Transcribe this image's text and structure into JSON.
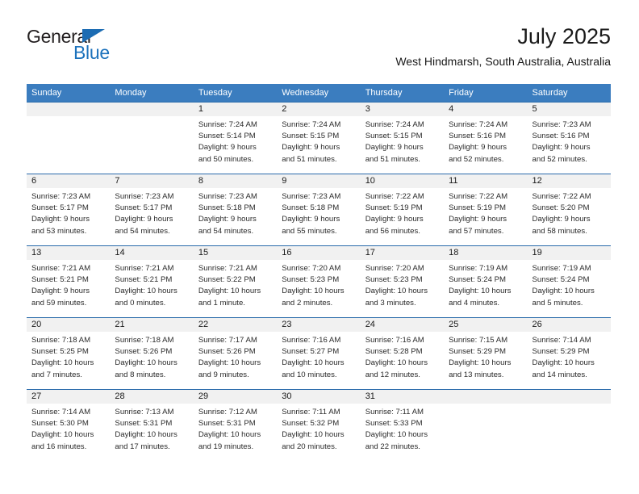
{
  "brand": {
    "name_part1": "General",
    "name_part2": "Blue"
  },
  "header": {
    "title": "July 2025",
    "subtitle": "West Hindmarsh, South Australia, Australia"
  },
  "colors": {
    "header_blue": "#3b7dbf",
    "row_rule_blue": "#2a6bab",
    "daynum_band": "#f1f1f1",
    "brand_blue": "#1c72bc",
    "text": "#1a1a1a"
  },
  "weekdays": [
    "Sunday",
    "Monday",
    "Tuesday",
    "Wednesday",
    "Thursday",
    "Friday",
    "Saturday"
  ],
  "weeks": [
    [
      {
        "day": "",
        "lines": []
      },
      {
        "day": "",
        "lines": []
      },
      {
        "day": "1",
        "lines": [
          "Sunrise: 7:24 AM",
          "Sunset: 5:14 PM",
          "Daylight: 9 hours",
          "and 50 minutes."
        ]
      },
      {
        "day": "2",
        "lines": [
          "Sunrise: 7:24 AM",
          "Sunset: 5:15 PM",
          "Daylight: 9 hours",
          "and 51 minutes."
        ]
      },
      {
        "day": "3",
        "lines": [
          "Sunrise: 7:24 AM",
          "Sunset: 5:15 PM",
          "Daylight: 9 hours",
          "and 51 minutes."
        ]
      },
      {
        "day": "4",
        "lines": [
          "Sunrise: 7:24 AM",
          "Sunset: 5:16 PM",
          "Daylight: 9 hours",
          "and 52 minutes."
        ]
      },
      {
        "day": "5",
        "lines": [
          "Sunrise: 7:23 AM",
          "Sunset: 5:16 PM",
          "Daylight: 9 hours",
          "and 52 minutes."
        ]
      }
    ],
    [
      {
        "day": "6",
        "lines": [
          "Sunrise: 7:23 AM",
          "Sunset: 5:17 PM",
          "Daylight: 9 hours",
          "and 53 minutes."
        ]
      },
      {
        "day": "7",
        "lines": [
          "Sunrise: 7:23 AM",
          "Sunset: 5:17 PM",
          "Daylight: 9 hours",
          "and 54 minutes."
        ]
      },
      {
        "day": "8",
        "lines": [
          "Sunrise: 7:23 AM",
          "Sunset: 5:18 PM",
          "Daylight: 9 hours",
          "and 54 minutes."
        ]
      },
      {
        "day": "9",
        "lines": [
          "Sunrise: 7:23 AM",
          "Sunset: 5:18 PM",
          "Daylight: 9 hours",
          "and 55 minutes."
        ]
      },
      {
        "day": "10",
        "lines": [
          "Sunrise: 7:22 AM",
          "Sunset: 5:19 PM",
          "Daylight: 9 hours",
          "and 56 minutes."
        ]
      },
      {
        "day": "11",
        "lines": [
          "Sunrise: 7:22 AM",
          "Sunset: 5:19 PM",
          "Daylight: 9 hours",
          "and 57 minutes."
        ]
      },
      {
        "day": "12",
        "lines": [
          "Sunrise: 7:22 AM",
          "Sunset: 5:20 PM",
          "Daylight: 9 hours",
          "and 58 minutes."
        ]
      }
    ],
    [
      {
        "day": "13",
        "lines": [
          "Sunrise: 7:21 AM",
          "Sunset: 5:21 PM",
          "Daylight: 9 hours",
          "and 59 minutes."
        ]
      },
      {
        "day": "14",
        "lines": [
          "Sunrise: 7:21 AM",
          "Sunset: 5:21 PM",
          "Daylight: 10 hours",
          "and 0 minutes."
        ]
      },
      {
        "day": "15",
        "lines": [
          "Sunrise: 7:21 AM",
          "Sunset: 5:22 PM",
          "Daylight: 10 hours",
          "and 1 minute."
        ]
      },
      {
        "day": "16",
        "lines": [
          "Sunrise: 7:20 AM",
          "Sunset: 5:23 PM",
          "Daylight: 10 hours",
          "and 2 minutes."
        ]
      },
      {
        "day": "17",
        "lines": [
          "Sunrise: 7:20 AM",
          "Sunset: 5:23 PM",
          "Daylight: 10 hours",
          "and 3 minutes."
        ]
      },
      {
        "day": "18",
        "lines": [
          "Sunrise: 7:19 AM",
          "Sunset: 5:24 PM",
          "Daylight: 10 hours",
          "and 4 minutes."
        ]
      },
      {
        "day": "19",
        "lines": [
          "Sunrise: 7:19 AM",
          "Sunset: 5:24 PM",
          "Daylight: 10 hours",
          "and 5 minutes."
        ]
      }
    ],
    [
      {
        "day": "20",
        "lines": [
          "Sunrise: 7:18 AM",
          "Sunset: 5:25 PM",
          "Daylight: 10 hours",
          "and 7 minutes."
        ]
      },
      {
        "day": "21",
        "lines": [
          "Sunrise: 7:18 AM",
          "Sunset: 5:26 PM",
          "Daylight: 10 hours",
          "and 8 minutes."
        ]
      },
      {
        "day": "22",
        "lines": [
          "Sunrise: 7:17 AM",
          "Sunset: 5:26 PM",
          "Daylight: 10 hours",
          "and 9 minutes."
        ]
      },
      {
        "day": "23",
        "lines": [
          "Sunrise: 7:16 AM",
          "Sunset: 5:27 PM",
          "Daylight: 10 hours",
          "and 10 minutes."
        ]
      },
      {
        "day": "24",
        "lines": [
          "Sunrise: 7:16 AM",
          "Sunset: 5:28 PM",
          "Daylight: 10 hours",
          "and 12 minutes."
        ]
      },
      {
        "day": "25",
        "lines": [
          "Sunrise: 7:15 AM",
          "Sunset: 5:29 PM",
          "Daylight: 10 hours",
          "and 13 minutes."
        ]
      },
      {
        "day": "26",
        "lines": [
          "Sunrise: 7:14 AM",
          "Sunset: 5:29 PM",
          "Daylight: 10 hours",
          "and 14 minutes."
        ]
      }
    ],
    [
      {
        "day": "27",
        "lines": [
          "Sunrise: 7:14 AM",
          "Sunset: 5:30 PM",
          "Daylight: 10 hours",
          "and 16 minutes."
        ]
      },
      {
        "day": "28",
        "lines": [
          "Sunrise: 7:13 AM",
          "Sunset: 5:31 PM",
          "Daylight: 10 hours",
          "and 17 minutes."
        ]
      },
      {
        "day": "29",
        "lines": [
          "Sunrise: 7:12 AM",
          "Sunset: 5:31 PM",
          "Daylight: 10 hours",
          "and 19 minutes."
        ]
      },
      {
        "day": "30",
        "lines": [
          "Sunrise: 7:11 AM",
          "Sunset: 5:32 PM",
          "Daylight: 10 hours",
          "and 20 minutes."
        ]
      },
      {
        "day": "31",
        "lines": [
          "Sunrise: 7:11 AM",
          "Sunset: 5:33 PM",
          "Daylight: 10 hours",
          "and 22 minutes."
        ]
      },
      {
        "day": "",
        "lines": []
      },
      {
        "day": "",
        "lines": []
      }
    ]
  ]
}
